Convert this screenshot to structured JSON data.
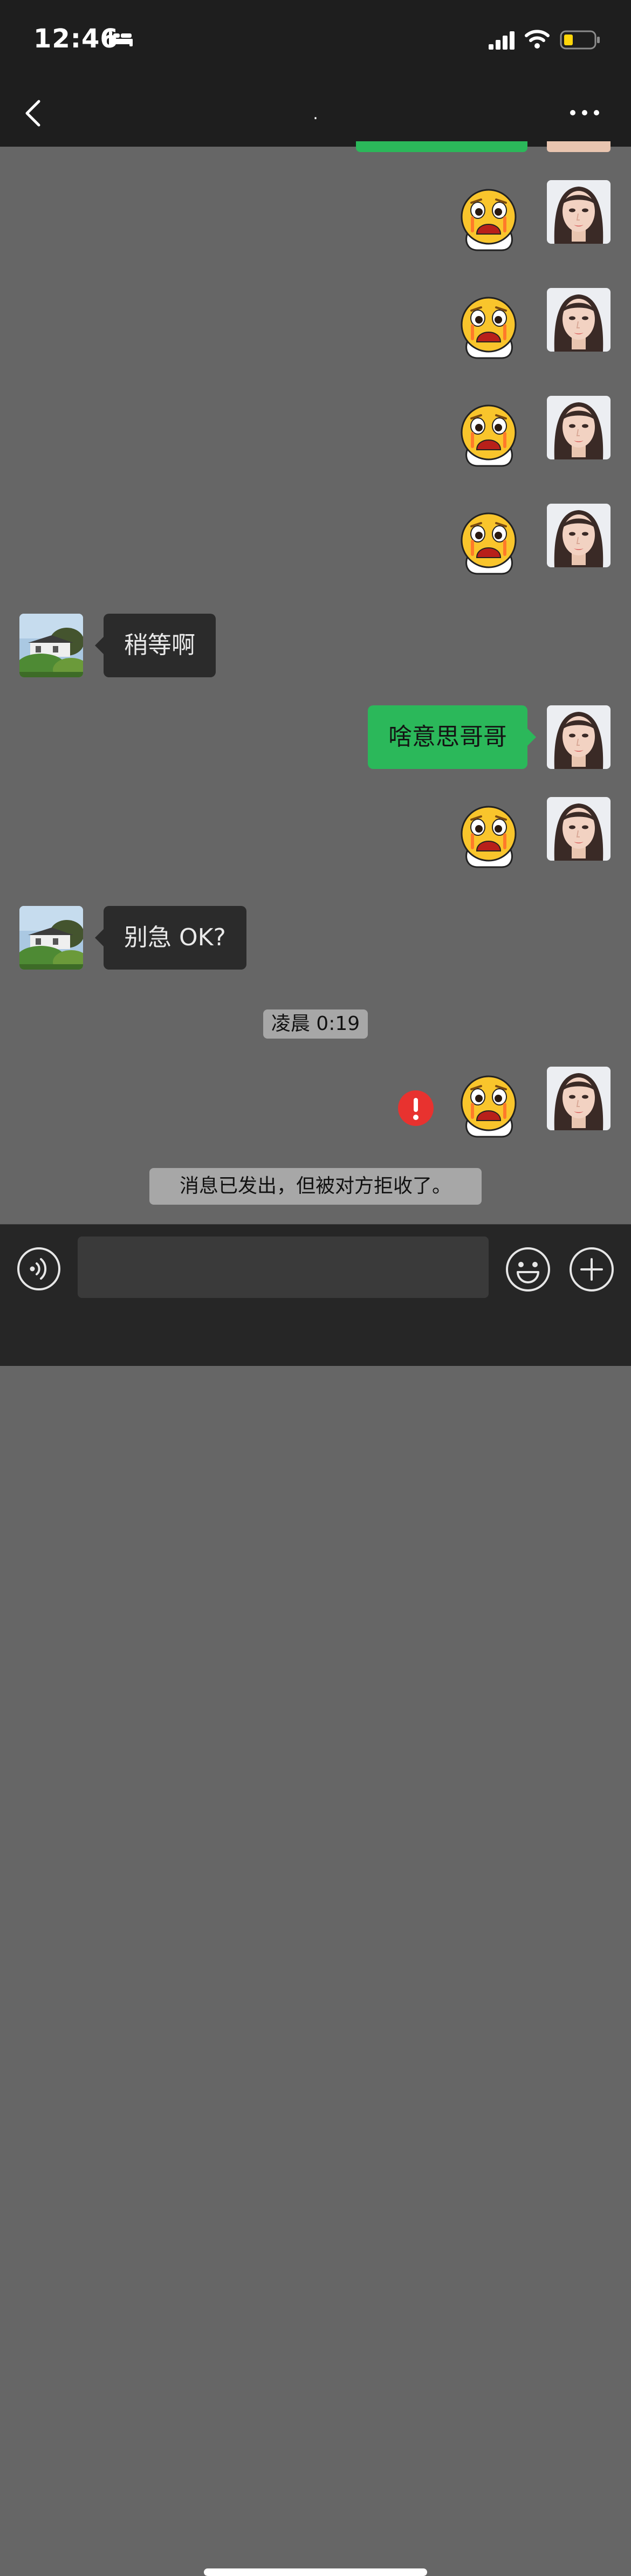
{
  "status_bar": {
    "time": "12:46"
  },
  "nav": {
    "title": "."
  },
  "messages": {
    "m1": "稍等啊",
    "m2": "啥意思哥哥",
    "m3": "别急 OK?"
  },
  "timestamp": "凌晨 0:19",
  "system_notice": "消息已发出，但被对方拒收了。",
  "input": {
    "value": ""
  },
  "colors": {
    "outgoing_bubble": "#2bb85a",
    "incoming_bubble": "#2b2b2b",
    "chat_background": "#666666",
    "error_badge": "#e8322f"
  }
}
